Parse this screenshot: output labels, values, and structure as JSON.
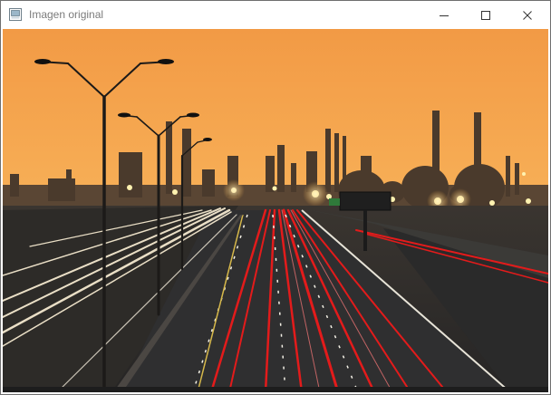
{
  "window": {
    "title": "Imagen original",
    "app_icon": "window-app-icon",
    "controls": {
      "minimize_icon": "minimize-icon",
      "maximize_icon": "maximize-icon",
      "close_icon": "close-icon"
    }
  },
  "image": {
    "description_icon": "photo-highway-refinery-night"
  },
  "colors": {
    "sky_top": "#f7a24a",
    "sky_horizon": "#ffcf7a",
    "tail_lights": "#e31b1b",
    "head_lights": "#fff3d8"
  }
}
